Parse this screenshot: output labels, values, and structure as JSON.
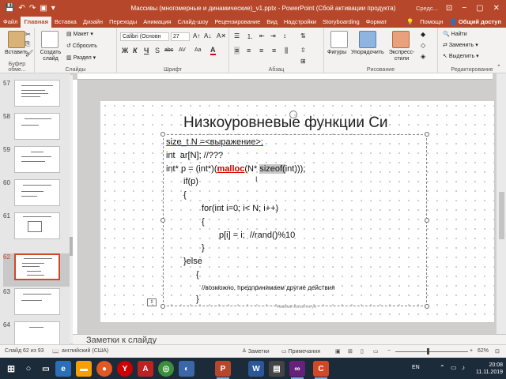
{
  "window": {
    "title": "Массивы (многомерные и динамические)_v1.pptx - PowerPoint (Сбой активации продукта)",
    "right_label": "Средс...",
    "controls": [
      "−",
      "▢",
      "✕"
    ]
  },
  "tabs": [
    "Файл",
    "Главная",
    "Вставка",
    "Дизайн",
    "Переходы",
    "Анимация",
    "Слайд-шоу",
    "Рецензирование",
    "Вид",
    "Надстройки",
    "Storyboarding",
    "Формат"
  ],
  "tabs_right": {
    "tell_me": "Помощн",
    "user": "Общий доступ"
  },
  "ribbon": {
    "clipboard": {
      "label": "Буфер обме...",
      "paste": "Вставить"
    },
    "slides": {
      "label": "Слайды",
      "new_slide": "Создать слайд",
      "layout": "Макет",
      "reset": "Сбросить",
      "section": "Раздел"
    },
    "font": {
      "label": "Шрифт",
      "font_name": "Calibri (Основн",
      "font_size": "27",
      "bold": "Ж",
      "italic": "К",
      "underline": "Ч",
      "strike": "S",
      "shadow": "abc",
      "spacing": "AV",
      "case": "Aa",
      "color": "A"
    },
    "paragraph": {
      "label": "Абзац"
    },
    "drawing": {
      "label": "Рисование",
      "shapes": "Фигуры",
      "arrange": "Упорядочить",
      "quick_styles": "Экспресс-стили"
    },
    "editing": {
      "label": "Редактирование",
      "find": "Найти",
      "replace": "Заменить",
      "select": "Выделить"
    }
  },
  "thumbnails": [
    {
      "num": "57",
      "selected": false
    },
    {
      "num": "58",
      "selected": false
    },
    {
      "num": "59",
      "selected": false
    },
    {
      "num": "60",
      "selected": false
    },
    {
      "num": "61",
      "selected": false
    },
    {
      "num": "62",
      "selected": true
    },
    {
      "num": "63",
      "selected": false
    },
    {
      "num": "64",
      "selected": false
    }
  ],
  "slide": {
    "title": "Низкоуровневые функции Си",
    "code": [
      "size_t N =<выражение>;",
      "int  ar[N]; //???",
      "int* p = (int*)(malloc(N* sizeof(int)));",
      "if(p)",
      "{",
      "for(int i=0; i< N; i++)",
      "{",
      "p[i] = i;  //rand()%10",
      "}",
      "}else",
      "{",
      "//возможно, предпринимаем другие действия",
      "}"
    ],
    "footer_placeholder": "Нижний колонтитул"
  },
  "notes": {
    "label": "Заметки к слайду"
  },
  "status": {
    "slide_counter": "Слайд 62 из 93",
    "language": "английский (США)",
    "notes": "Заметки",
    "comments": "Примечания",
    "zoom": "62%"
  },
  "taskbar": {
    "lang": "EN",
    "time": "20:08",
    "date": "11.11.2019"
  },
  "colors": {
    "accent": "#b7472a",
    "selected_thumb": "#d24726",
    "malloc": "#c00000"
  }
}
